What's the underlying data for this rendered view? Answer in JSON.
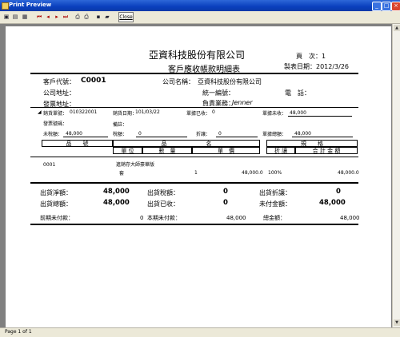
{
  "window": {
    "title": "Print Preview"
  },
  "toolbar": {
    "close_label": "Close"
  },
  "report": {
    "company": "亞資科技股份有限公司",
    "subtitle": "客戶應收帳款明細表",
    "page_label": "頁　次：1",
    "date_label": "製表日期：2012/3/26"
  },
  "customer": {
    "code_label": "客戶代號：",
    "code": "C0001",
    "name_label": "公司名稱：",
    "name": "亞資科技股份有限公司",
    "addr_label": "公司地址：",
    "taxid_label": "統一編號：",
    "phone_label": "電　話：",
    "invaddr_label": "發票地址：",
    "sales_label": "負責業務：",
    "sales": "Jenner"
  },
  "sale": {
    "no_label": "銷貨單號：",
    "no": "010322001",
    "date_label": "銷貨日期：",
    "date": "101/03/22",
    "received_label": "單據已收：",
    "received": "0",
    "unreceived_label": "單據未收：",
    "unreceived": "48,000",
    "invoice_label": "發票號碼：",
    "note_label": "備註：",
    "untaxed_label": "未稅額：",
    "untaxed": "48,000",
    "tax_label": "稅額：",
    "tax": "0",
    "discount_label": "折讓：",
    "discount": "0",
    "total_label": "單據總額：",
    "total": "48,000"
  },
  "table": {
    "h_code": "品　　號",
    "h_name": "品　　　　　　　名",
    "h_spec": "規　　格",
    "h_unit": "單 位",
    "h_qty": "數　量",
    "h_price": "單　價",
    "h_disc": "折 讓",
    "h_amount": "合 計 金 額",
    "rows": [
      {
        "code": "0001",
        "name": "進銷存大師豪華版",
        "unit": "套",
        "qty": "1",
        "price": "48,000.0",
        "disc": "100%",
        "amount": "48,000.0"
      }
    ]
  },
  "summary": {
    "net_ship_label": "出貨淨額：",
    "net_ship": "48,000",
    "ship_tax_label": "出貨稅額：",
    "ship_tax": "0",
    "ship_disc_label": "出貨折讓：",
    "ship_disc": "0",
    "total_ship_label": "出貨總額：",
    "total_ship": "48,000",
    "ship_recv_label": "出貨已收：",
    "ship_recv": "0",
    "unpaid_label": "未付金額：",
    "unpaid": "48,000",
    "prev_unpaid_label": "前期未付款：",
    "prev_unpaid": "0",
    "cur_unpaid_label": "本期未付款：",
    "cur_unpaid": "48,000",
    "grand_label": "總金額：",
    "grand": "48,000"
  },
  "status": {
    "page": "Page 1 of 1"
  }
}
